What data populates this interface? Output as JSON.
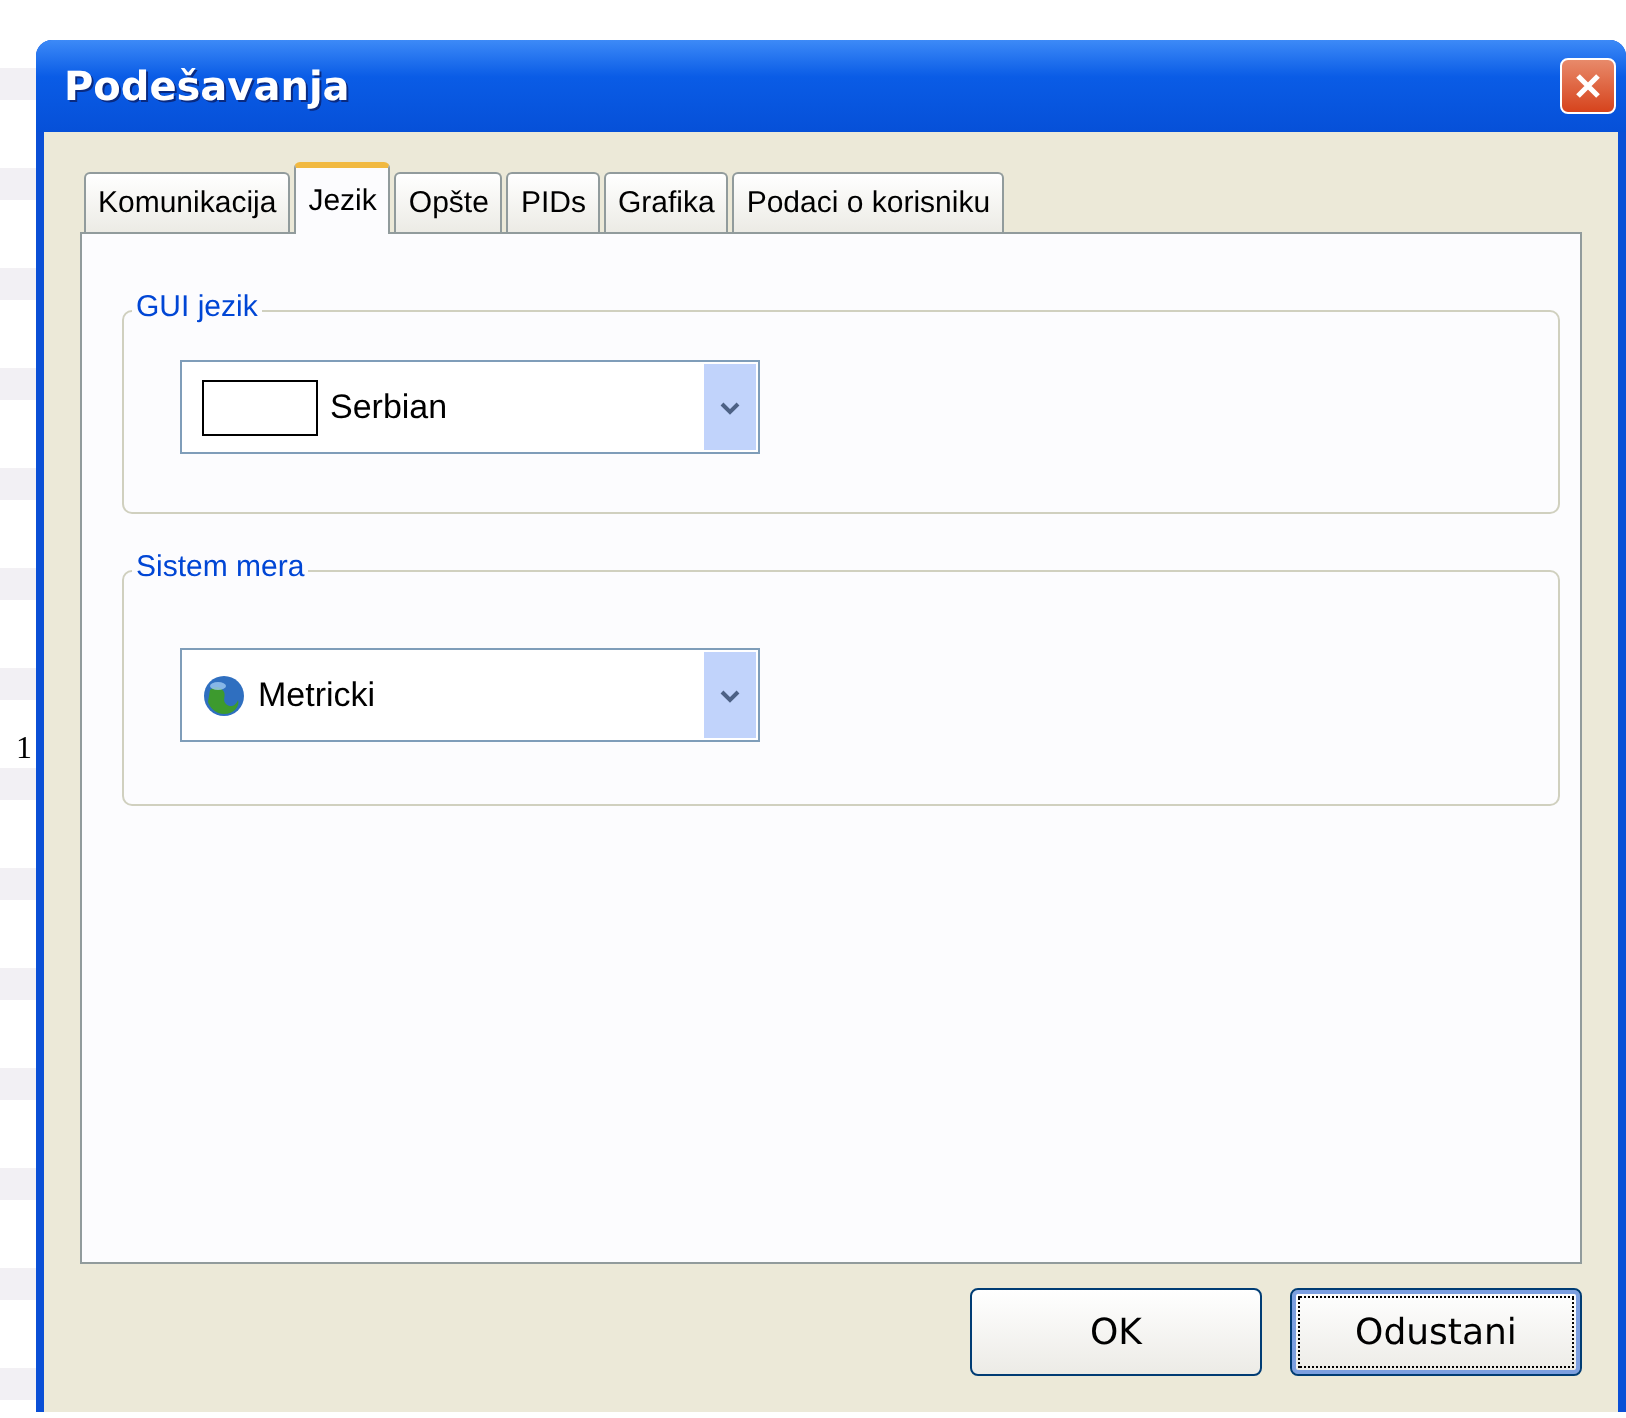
{
  "background_fragment": "1",
  "window": {
    "title": "Podešavanja"
  },
  "tabs": [
    {
      "label": "Komunikacija",
      "selected": false
    },
    {
      "label": "Jezik",
      "selected": true
    },
    {
      "label": "Opšte",
      "selected": false
    },
    {
      "label": "PIDs",
      "selected": false
    },
    {
      "label": "Grafika",
      "selected": false
    },
    {
      "label": "Podaci o korisniku",
      "selected": false
    }
  ],
  "groups": [
    {
      "title": "GUI jezik",
      "dropdown": {
        "value": "Serbian"
      }
    },
    {
      "title": "Sistem mera",
      "dropdown": {
        "value": "Metricki"
      }
    }
  ],
  "buttons": [
    {
      "label": "OK",
      "focused": false
    },
    {
      "label": "Odustani",
      "focused": true
    }
  ]
}
